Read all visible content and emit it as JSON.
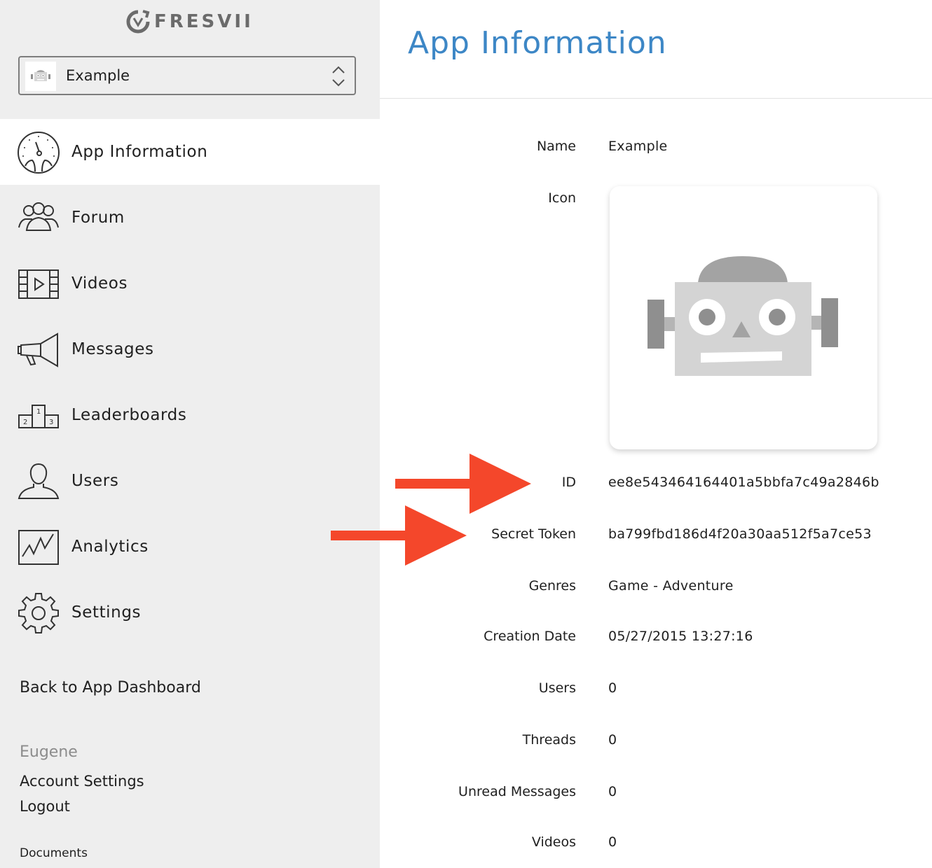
{
  "brand": {
    "name": "FRESVII"
  },
  "app_selector": {
    "selected": "Example"
  },
  "nav": {
    "items": [
      {
        "label": "App Information",
        "icon": "dashboard-icon",
        "active": true
      },
      {
        "label": "Forum",
        "icon": "users-group-icon"
      },
      {
        "label": "Videos",
        "icon": "video-icon"
      },
      {
        "label": "Messages",
        "icon": "megaphone-icon"
      },
      {
        "label": "Leaderboards",
        "icon": "podium-icon"
      },
      {
        "label": "Users",
        "icon": "user-icon"
      },
      {
        "label": "Analytics",
        "icon": "chart-icon"
      },
      {
        "label": "Settings",
        "icon": "gear-icon"
      }
    ]
  },
  "sidebar_footer": {
    "back_link": "Back to App Dashboard",
    "username": "Eugene",
    "account_settings": "Account Settings",
    "logout": "Logout",
    "documents": "Documents"
  },
  "main": {
    "title": "App Information",
    "fields": {
      "name": {
        "label": "Name",
        "value": "Example"
      },
      "icon": {
        "label": "Icon"
      },
      "id": {
        "label": "ID",
        "value": "ee8e543464164401a5bbfa7c49a2846b"
      },
      "secret_token": {
        "label": "Secret Token",
        "value": "ba799fbd186d4f20a30aa512f5a7ce53"
      },
      "genres": {
        "label": "Genres",
        "value": "Game - Adventure"
      },
      "creation_date": {
        "label": "Creation Date",
        "value": "05/27/2015 13:27:16"
      },
      "users": {
        "label": "Users",
        "value": "0"
      },
      "threads": {
        "label": "Threads",
        "value": "0"
      },
      "unread_messages": {
        "label": "Unread Messages",
        "value": "0"
      },
      "videos": {
        "label": "Videos",
        "value": "0"
      }
    }
  },
  "colors": {
    "accent": "#3d87c6",
    "annotation_arrow": "#f4472b",
    "sidebar_bg": "#eeeeee"
  }
}
